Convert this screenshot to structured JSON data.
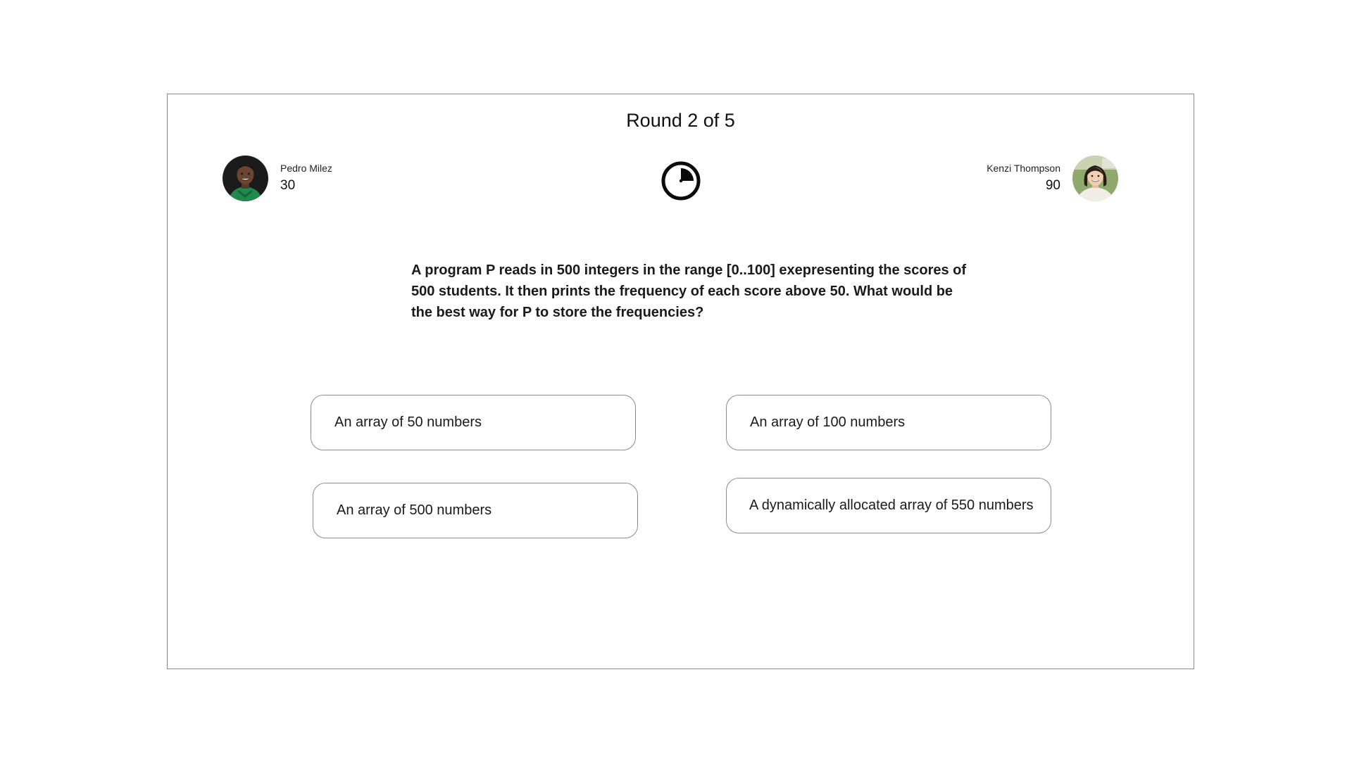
{
  "round": {
    "title": "Round 2 of 5"
  },
  "players": {
    "left": {
      "name": "Pedro Milez",
      "score": "30",
      "avatar_icon": "avatar-photo-man"
    },
    "right": {
      "name": "Kenzi Thompson",
      "score": "90",
      "avatar_icon": "avatar-photo-woman"
    }
  },
  "timer": {
    "icon": "timer-icon",
    "elapsed_fraction": 0.25
  },
  "question": {
    "text": "A program P reads in 500 integers in the range [0..100] exepresenting the scores of 500 students. It then prints the frequency of each score above 50. What would be the best way for P to store the frequencies?"
  },
  "answers": [
    {
      "label": "An array of 50 numbers"
    },
    {
      "label": "An array of 100 numbers"
    },
    {
      "label": "An array of 500 numbers"
    },
    {
      "label": "A dynamically allocated array of 550 numbers"
    }
  ],
  "colors": {
    "border": "#8c8c8c",
    "text": "#111111",
    "background": "#ffffff"
  }
}
